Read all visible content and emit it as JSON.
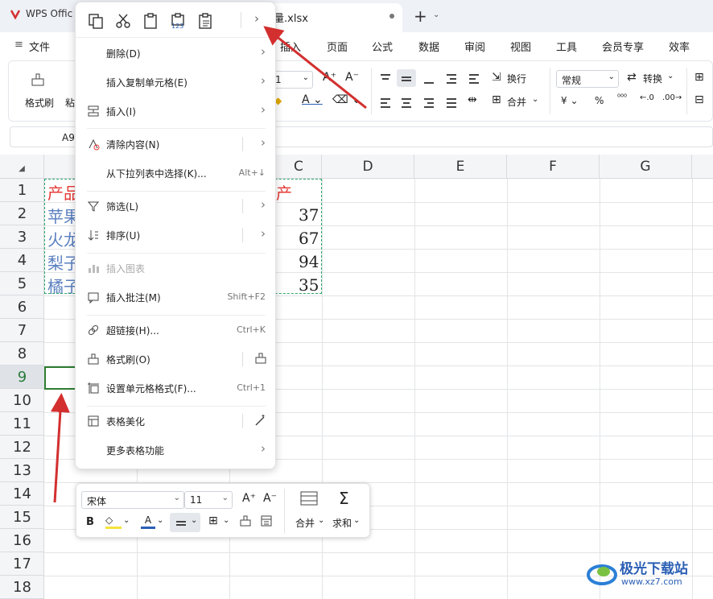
{
  "app": {
    "wps_tab_label": "WPS Offic",
    "file_tab_label": "量.xlsx"
  },
  "menubar": {
    "file_label": "文件",
    "tabs": [
      "插入",
      "页面",
      "公式",
      "数据",
      "审阅",
      "视图",
      "工具",
      "会员专享",
      "效率"
    ]
  },
  "ribbon": {
    "format_painter": "格式刷",
    "paste": "粘",
    "font_size": "1",
    "wrap": "换行",
    "merge": "合并",
    "number_format": "常规",
    "convert": "转换",
    "percent": "%"
  },
  "formula_bar": {
    "name_box": "A9"
  },
  "sheet": {
    "columns": [
      "C",
      "D",
      "E",
      "F",
      "G"
    ],
    "rows": [
      "1",
      "2",
      "3",
      "4",
      "5",
      "6",
      "7",
      "8",
      "9",
      "10",
      "11",
      "12",
      "13",
      "14",
      "15",
      "16",
      "17",
      "18"
    ],
    "active_row": "9",
    "col_a_visible": [
      "产品",
      "苹果",
      "火龙",
      "梨子",
      "橘子"
    ],
    "col_c_header_fragment": "产",
    "col_c_values": [
      "37",
      "67",
      "94",
      "35"
    ],
    "text_color_header": "#e53935",
    "text_color_items": "#5a7fbf"
  },
  "context_menu": {
    "items": [
      {
        "label": "删除(D)",
        "shortcut": "",
        "submenu": true
      },
      {
        "label": "插入复制单元格(E)",
        "shortcut": "",
        "submenu": true
      },
      {
        "label": "插入(I)",
        "shortcut": "",
        "submenu": true
      },
      {
        "label": "清除内容(N)",
        "shortcut": "",
        "submenu": true
      },
      {
        "label": "从下拉列表中选择(K)...",
        "shortcut": "Alt+↓",
        "submenu": false
      },
      {
        "label": "筛选(L)",
        "shortcut": "",
        "submenu": true
      },
      {
        "label": "排序(U)",
        "shortcut": "",
        "submenu": true
      },
      {
        "label": "插入图表",
        "shortcut": "",
        "submenu": false
      },
      {
        "label": "插入批注(M)",
        "shortcut": "Shift+F2",
        "submenu": false
      },
      {
        "label": "超链接(H)...",
        "shortcut": "Ctrl+K",
        "submenu": false
      },
      {
        "label": "格式刷(O)",
        "shortcut": "",
        "submenu": false
      },
      {
        "label": "设置单元格格式(F)...",
        "shortcut": "Ctrl+1",
        "submenu": false
      },
      {
        "label": "表格美化",
        "shortcut": "",
        "submenu": false
      },
      {
        "label": "更多表格功能",
        "shortcut": "",
        "submenu": true
      }
    ],
    "paste_special_label": "123"
  },
  "mini_toolbar": {
    "font_name": "宋体",
    "font_size": "11",
    "bold": "B",
    "merge_label": "合并",
    "sum_label": "求和"
  },
  "watermark": {
    "brand": "极光下载站",
    "url": "www.xz7.com"
  },
  "colors": {
    "accent_red": "#d32f2f",
    "grid_green": "#2e7d32",
    "copy_border": "#2aa86b"
  }
}
